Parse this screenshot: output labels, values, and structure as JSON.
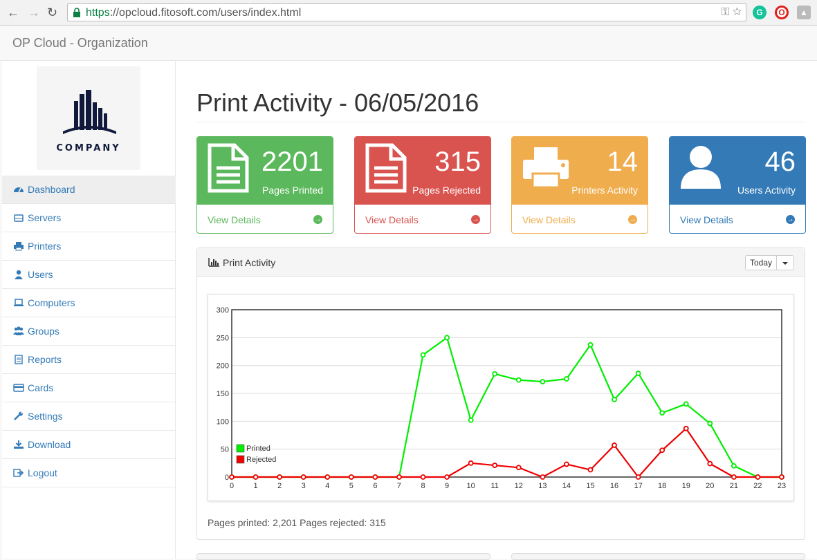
{
  "browser": {
    "url_scheme": "https",
    "url_rest": "://opcloud.fitosoft.com/users/index.html"
  },
  "header": {
    "brand": "OP Cloud - Organization"
  },
  "sidebar": {
    "logo_text": "COMPANY",
    "items": [
      {
        "label": "Dashboard",
        "icon": "dashboard-icon"
      },
      {
        "label": "Servers",
        "icon": "server-icon"
      },
      {
        "label": "Printers",
        "icon": "printer-icon"
      },
      {
        "label": "Users",
        "icon": "user-icon"
      },
      {
        "label": "Computers",
        "icon": "laptop-icon"
      },
      {
        "label": "Groups",
        "icon": "group-icon"
      },
      {
        "label": "Reports",
        "icon": "report-icon"
      },
      {
        "label": "Cards",
        "icon": "card-icon"
      },
      {
        "label": "Settings",
        "icon": "wrench-icon"
      },
      {
        "label": "Download",
        "icon": "download-icon"
      },
      {
        "label": "Logout",
        "icon": "logout-icon"
      }
    ]
  },
  "main": {
    "title": "Print Activity - 06/05/2016",
    "cards": [
      {
        "value": "2201",
        "label": "Pages Printed",
        "link": "View Details",
        "color": "#5cb85c"
      },
      {
        "value": "315",
        "label": "Pages Rejected",
        "link": "View Details",
        "color": "#d9534f"
      },
      {
        "value": "14",
        "label": "Printers Activity",
        "link": "View Details",
        "color": "#f0ad4e"
      },
      {
        "value": "46",
        "label": "Users Activity",
        "link": "View Details",
        "color": "#337ab7"
      }
    ],
    "panel": {
      "title": "Print Activity",
      "dropdown": "Today",
      "summary": "Pages printed: 2,201 Pages rejected: 315"
    }
  },
  "chart_data": {
    "type": "line",
    "x": [
      0,
      1,
      2,
      3,
      4,
      5,
      6,
      7,
      8,
      9,
      10,
      11,
      12,
      13,
      14,
      15,
      16,
      17,
      18,
      19,
      20,
      21,
      22,
      23
    ],
    "ylim": [
      0,
      300
    ],
    "yticks": [
      0,
      50,
      100,
      150,
      200,
      250,
      300
    ],
    "grid": true,
    "legend_position": "bottom-left",
    "series": [
      {
        "name": "Printed",
        "color": "#00ee00",
        "values": [
          0,
          0,
          0,
          0,
          0,
          0,
          0,
          0,
          219,
          250,
          102,
          185,
          174,
          171,
          176,
          237,
          139,
          186,
          115,
          131,
          96,
          20,
          0,
          0
        ]
      },
      {
        "name": "Rejected",
        "color": "#ee0000",
        "values": [
          0,
          0,
          0,
          0,
          0,
          0,
          0,
          0,
          0,
          0,
          25,
          21,
          17,
          0,
          23,
          13,
          57,
          0,
          48,
          87,
          24,
          0,
          0,
          0
        ]
      }
    ]
  }
}
